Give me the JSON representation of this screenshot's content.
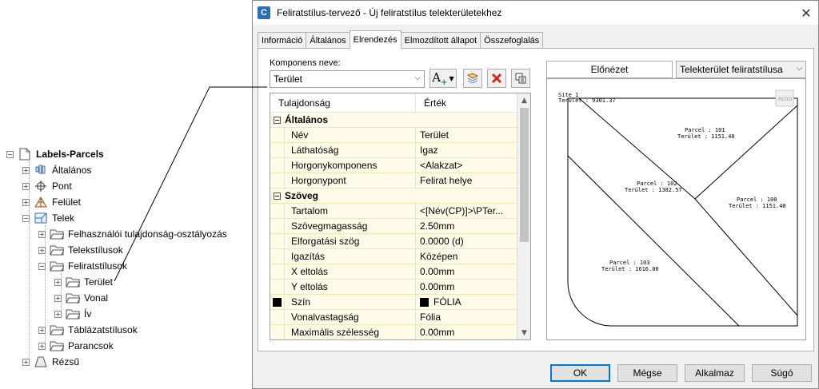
{
  "tree": {
    "root": "Labels-Parcels",
    "items": [
      {
        "label": "Általános"
      },
      {
        "label": "Pont"
      },
      {
        "label": "Felület"
      },
      {
        "label": "Telek"
      },
      {
        "label": "Felhasználói tulajdonság-osztályozás"
      },
      {
        "label": "Telekstílusok"
      },
      {
        "label": "Feliratstílusok"
      },
      {
        "label": "Terület"
      },
      {
        "label": "Vonal"
      },
      {
        "label": "Ív"
      },
      {
        "label": "Táblázatstílusok"
      },
      {
        "label": "Parancsok"
      },
      {
        "label": "Rézsű"
      }
    ]
  },
  "dialog": {
    "title": "Feliratstílus-tervező - Új feliratstílus telekterületekhez",
    "app_icon_letter": "C",
    "close_glyph": "✕",
    "tabs": [
      "Információ",
      "Általános",
      "Elrendezés",
      "Elmozdított állapot",
      "Összefoglalás"
    ],
    "active_tab": "Elrendezés",
    "component_label": "Komponens neve:",
    "component_value": "Terület",
    "toolbar": {
      "add_text_glyph": "A",
      "add_text_plus": "+"
    },
    "grid": {
      "col_property": "Tulajdonság",
      "col_value": "Érték",
      "rows": [
        {
          "type": "cat",
          "name": "Általános"
        },
        {
          "type": "prop",
          "name": "Név",
          "value": "Terület"
        },
        {
          "type": "prop",
          "name": "Láthatóság",
          "value": "Igaz"
        },
        {
          "type": "prop",
          "name": "Horgonykomponens",
          "value": "<Alakzat>"
        },
        {
          "type": "prop",
          "name": "Horgonypont",
          "value": "Felirat helye"
        },
        {
          "type": "cat",
          "name": "Szöveg"
        },
        {
          "type": "prop",
          "name": "Tartalom",
          "value": "<[Név(CP)]>\\PTer..."
        },
        {
          "type": "prop",
          "name": "Szövegmagasság",
          "value": "2.50mm"
        },
        {
          "type": "prop",
          "name": "Elforgatási szög",
          "value": "0.0000 (d)"
        },
        {
          "type": "prop",
          "name": "Igazítás",
          "value": "Középen"
        },
        {
          "type": "prop",
          "name": "X eltolás",
          "value": "0.00mm"
        },
        {
          "type": "prop",
          "name": "Y eltolás",
          "value": "0.00mm"
        },
        {
          "type": "prop",
          "name": "Szín",
          "value": "FÓLIA",
          "swatch": true
        },
        {
          "type": "prop",
          "name": "Vonalvastagság",
          "value": "Fólia"
        },
        {
          "type": "prop",
          "name": "Maximális szélesség",
          "value": "0.00mm"
        }
      ]
    },
    "preview": {
      "label": "Előnézet",
      "style_select": "Telekterület feliratstílusa",
      "site_label": "Site 1",
      "site_area": "Terület : 9301.37",
      "stamp": "REDO",
      "parcels": [
        {
          "name": "Parcel : 101",
          "area": "Terület : 1151.40"
        },
        {
          "name": "Parcel : 102",
          "area": "Terület : 1382.57"
        },
        {
          "name": "Parcel : 100",
          "area": "Terület : 1151.40"
        },
        {
          "name": "Parcel : 103",
          "area": "Terület : 1616.00"
        }
      ]
    },
    "buttons": {
      "ok": "OK",
      "cancel": "Mégse",
      "apply": "Alkalmaz",
      "help": "Súgó"
    }
  },
  "colors": {
    "accent": "#0078d7",
    "grid_value_bg": "#fffbe8",
    "grid_line": "#f0e6b4"
  }
}
